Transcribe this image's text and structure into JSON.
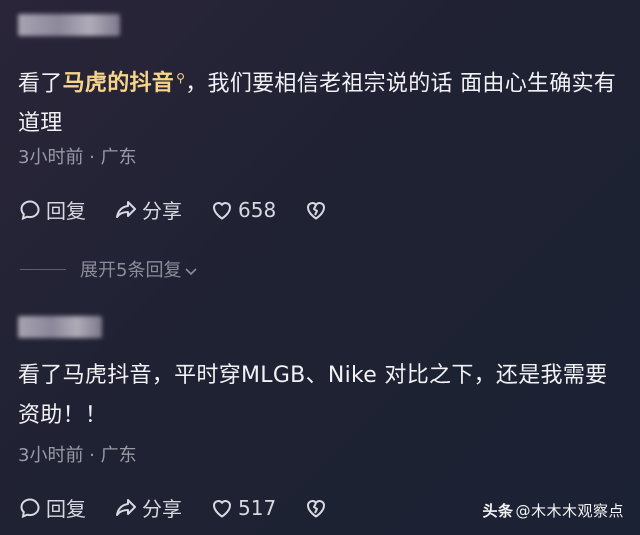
{
  "comments": [
    {
      "username": "",
      "text_prefix": "看了",
      "link_text": "马虎的抖音",
      "text_suffix": "，我们要相信老祖宗说的话  面由心生确实有道理",
      "meta": "3小时前 · 广东",
      "reply_label": "回复",
      "share_label": "分享",
      "like_count": "658",
      "expand_label": "展开5条回复"
    },
    {
      "username": "",
      "text": "看了马虎抖音，平时穿MLGB、Nike 对比之下，还是我需要资助！！",
      "meta": "3小时前 · 广东",
      "reply_label": "回复",
      "share_label": "分享",
      "like_count": "517"
    }
  ],
  "watermark": {
    "brand": "头条",
    "handle": "@木木木观察点"
  },
  "icons": {
    "reply": "speech-bubble-icon",
    "share": "share-arrow-icon",
    "like": "heart-outline-icon",
    "dislike": "broken-heart-icon",
    "search": "search-icon",
    "expand": "chevron-down-icon"
  },
  "colors": {
    "link": "#f6d58a",
    "meta": "#9a99a6",
    "text": "#f2f2f5"
  }
}
